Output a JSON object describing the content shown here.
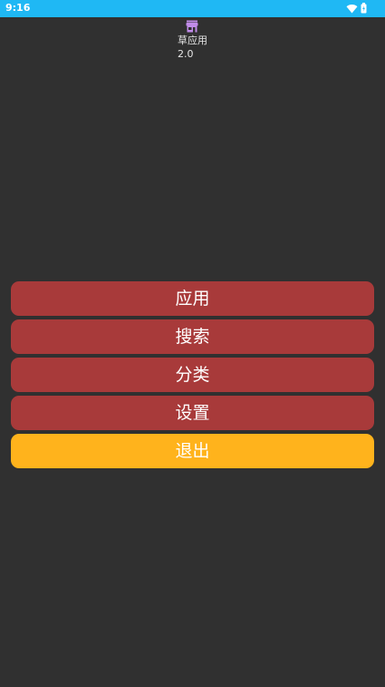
{
  "status_bar": {
    "time": "9:16",
    "icons": [
      "wifi-icon",
      "battery-icon"
    ]
  },
  "app": {
    "icon": "store-icon",
    "name": "草应用",
    "version": "2.0"
  },
  "menu": {
    "items": [
      {
        "label": "应用",
        "color": "#a83a3a"
      },
      {
        "label": "搜索",
        "color": "#a83a3a"
      },
      {
        "label": "分类",
        "color": "#a83a3a"
      },
      {
        "label": "设置",
        "color": "#a83a3a"
      },
      {
        "label": "退出",
        "color": "#ffb31c"
      }
    ]
  },
  "colors": {
    "status_bar": "#1fb8f4",
    "background": "#303030",
    "button": "#a83a3a",
    "exit_button": "#ffb31c",
    "icon_accent": "#c08be8"
  }
}
